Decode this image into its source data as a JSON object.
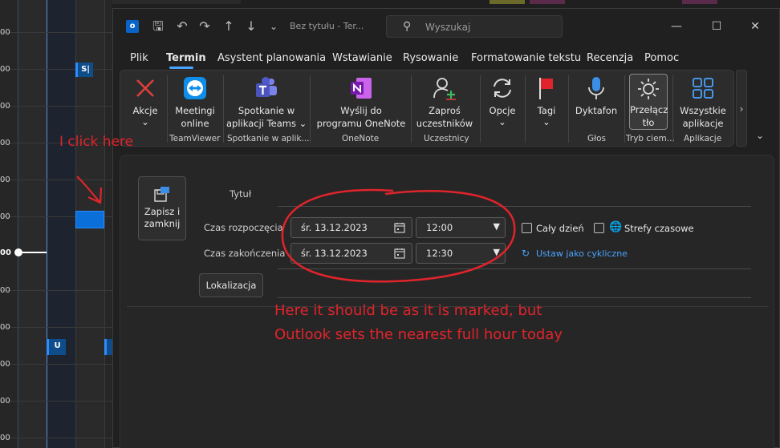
{
  "background_calendar": {
    "hour_labels": [
      "00",
      "00",
      "00",
      "00",
      "00",
      "00",
      "00",
      "00",
      "00",
      "00",
      "00",
      "00"
    ],
    "events": [
      {
        "label": "S|"
      },
      {
        "label": "U"
      }
    ]
  },
  "window": {
    "title": "Bez tytułu  -  Ter...",
    "app_icon_letter": "o",
    "search_placeholder": "Wyszukaj",
    "tabs": [
      "Plik",
      "Termin",
      "Asystent planowania",
      "Wstawianie",
      "Rysowanie",
      "Formatowanie tekstu",
      "Recenzja",
      "Pomoc"
    ],
    "active_tab": "Termin"
  },
  "ribbon": {
    "groups": [
      {
        "label": "",
        "buttons": [
          {
            "label": "Akcje",
            "label2": "⌄",
            "icon": "close-x-icon"
          }
        ]
      },
      {
        "label": "TeamViewer",
        "buttons": [
          {
            "label": "Meetingi",
            "label2": "online",
            "icon": "teamviewer-icon"
          }
        ]
      },
      {
        "label": "Spotkanie w aplik...",
        "buttons": [
          {
            "label": "Spotkanie w",
            "label2": "aplikacji Teams ⌄",
            "icon": "teams-icon"
          }
        ]
      },
      {
        "label": "OneNote",
        "buttons": [
          {
            "label": "Wyślij do",
            "label2": "programu OneNote",
            "icon": "onenote-icon"
          }
        ]
      },
      {
        "label": "Uczestnicy",
        "buttons": [
          {
            "label": "Zaproś",
            "label2": "uczestników",
            "icon": "add-person-icon"
          }
        ]
      },
      {
        "label": "",
        "buttons": [
          {
            "label": "Opcje",
            "label2": "⌄",
            "icon": "refresh-icon"
          }
        ]
      },
      {
        "label": "",
        "buttons": [
          {
            "label": "Tagi",
            "label2": "⌄",
            "icon": "flag-icon"
          }
        ]
      },
      {
        "label": "Głos",
        "buttons": [
          {
            "label": "Dyktafon",
            "label2": "",
            "icon": "microphone-icon"
          }
        ]
      },
      {
        "label": "Tryb ciem...",
        "buttons": [
          {
            "label": "Przełącz",
            "label2": "tło",
            "icon": "sun-icon"
          }
        ]
      },
      {
        "label": "Aplikacje",
        "buttons": [
          {
            "label": "Wszystkie",
            "label2": "aplikacje",
            "icon": "apps-grid-icon"
          }
        ]
      }
    ]
  },
  "form": {
    "save_label_1": "Zapisz i",
    "save_label_2": "zamknij",
    "title_label": "Tytuł",
    "start_label": "Czas rozpoczęcia",
    "end_label": "Czas zakończenia",
    "start_date": "śr. 13.12.2023",
    "start_time": "12:00",
    "end_date": "śr. 13.12.2023",
    "end_time": "12:30",
    "all_day_label": "Cały dzień",
    "time_zones_label": "Strefy czasowe",
    "recurring_label": "Ustaw jako cykliczne",
    "location_label": "Lokalizacja"
  },
  "annotations": {
    "click_here": "I click here",
    "note_line1": "Here it should be as it is marked, but",
    "note_line2": "Outlook sets the nearest full hour today",
    "color": "#e0242b"
  }
}
